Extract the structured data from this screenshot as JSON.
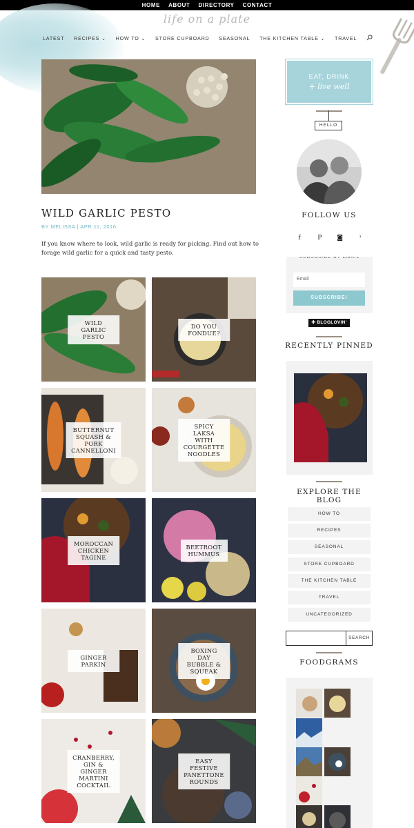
{
  "topnav": [
    "HOME",
    "ABOUT",
    "DIRECTORY",
    "CONTACT"
  ],
  "site": {
    "logo": "life on a plate"
  },
  "mainnav": [
    "LATEST",
    "RECIPES ⌄",
    "HOW TO ⌄",
    "STORE CUPBOARD",
    "SEASONAL",
    "THE KITCHEN TABLE ⌄",
    "TRAVEL"
  ],
  "post": {
    "title": "WILD GARLIC PESTO",
    "meta": "BY MELISSA | APR 11, 2016",
    "excerpt": "If you know where to look, wild garlic is ready for picking. Find out how to forage wild garlic for a quick and tasty pesto."
  },
  "tiles": [
    {
      "caption": "WILD GARLIC\nPESTO"
    },
    {
      "caption": "DO YOU FONDUE?"
    },
    {
      "caption": "BUTTERNUT\nSQUASH & PORK\nCANNELLONI"
    },
    {
      "caption": "SPICY LAKSA WITH\nCOURGETTE\nNOODLES"
    },
    {
      "caption": "MOROCCAN\nCHICKEN TAGINE"
    },
    {
      "caption": "BEETROOT\nHUMMUS"
    },
    {
      "caption": "GINGER PARKIN"
    },
    {
      "caption": "BOXING DAY\nBUBBLE & SQUEAK"
    },
    {
      "caption": "CRANBERRY, GIN &\nGINGER MARTINI\nCOCKTAIL"
    },
    {
      "caption": "EASY FESTIVE\nPANETTONE\nROUNDS"
    }
  ],
  "sidebar": {
    "banner_line1": "EAT, DRINK",
    "banner_line2": "+ live well",
    "hello": "HELLO",
    "follow": "FOLLOW US",
    "social": [
      "f",
      "P",
      "◙",
      "⁾"
    ],
    "subscribe_title": "SUBSCRIBE BY EMAIL",
    "email_placeholder": "Email",
    "subscribe_button": "SUBSCRIBE!",
    "bloglovin": "✚ BLOGLOVIN'",
    "recently_pinned": "RECENTLY PINNED",
    "explore": "EXPLORE THE BLOG",
    "categories": [
      "HOW TO",
      "RECIPES",
      "SEASONAL",
      "STORE CUPBOARD",
      "THE KITCHEN TABLE",
      "TRAVEL",
      "UNCATEGORIZED"
    ],
    "search_button": "SEARCH",
    "foodgrams": "FOODGRAMS"
  },
  "colors": {
    "accent": "#6fb8c2",
    "banner": "#a6d4da",
    "rule": "#9c8f84"
  }
}
